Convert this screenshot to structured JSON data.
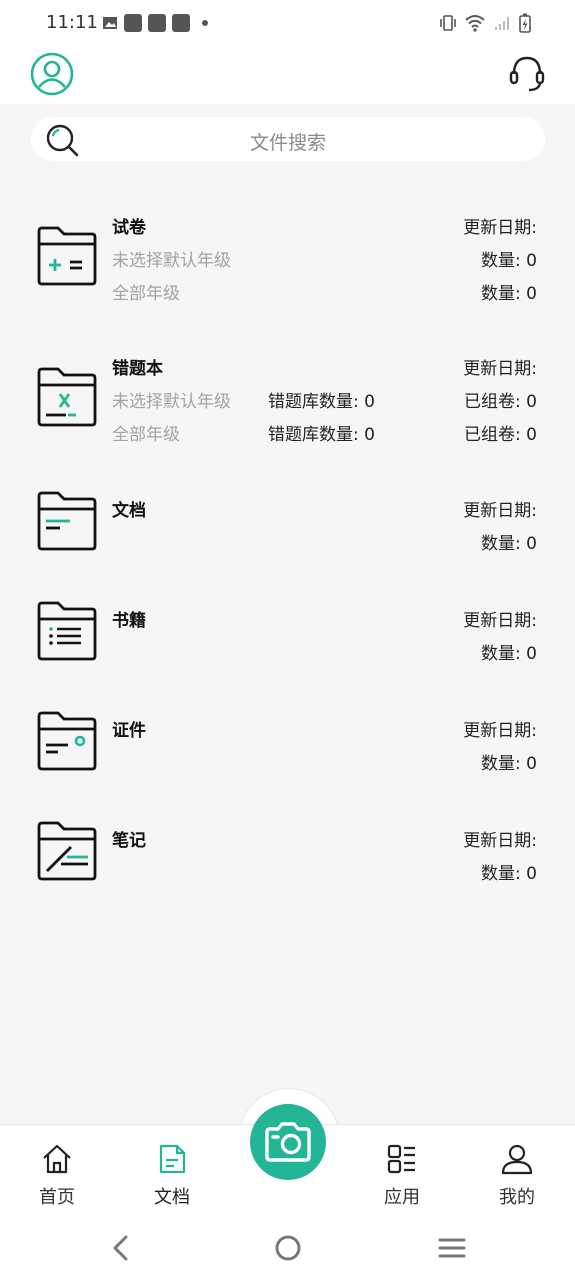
{
  "status": {
    "time": "11:11"
  },
  "search": {
    "placeholder": "文件搜索"
  },
  "folders": [
    {
      "title": "试卷",
      "line1_gray": "未选择默认年级",
      "line2_gray": "全部年级",
      "right0": "更新日期:",
      "right1": "数量: 0",
      "right2": "数量: 0"
    },
    {
      "title": "错题本",
      "line1_gray": "未选择默认年级",
      "line2_gray": "全部年级",
      "mid1": "错题库数量: 0",
      "mid2": "错题库数量: 0",
      "right0": "更新日期:",
      "right1": "已组卷: 0",
      "right2": "已组卷: 0"
    },
    {
      "title": "文档",
      "right0": "更新日期:",
      "right1": "数量: 0"
    },
    {
      "title": "书籍",
      "right0": "更新日期:",
      "right1": "数量: 0"
    },
    {
      "title": "证件",
      "right0": "更新日期:",
      "right1": "数量: 0"
    },
    {
      "title": "笔记",
      "right0": "更新日期:",
      "right1": "数量: 0"
    }
  ],
  "tabs": [
    {
      "label": "首页",
      "icon": "home-icon"
    },
    {
      "label": "文档",
      "icon": "document-icon",
      "active": true
    },
    {
      "label": "应用",
      "icon": "apps-icon"
    },
    {
      "label": "我的",
      "icon": "profile-icon"
    }
  ],
  "colors": {
    "accent": "#23b597",
    "background": "#f6f6f6"
  }
}
